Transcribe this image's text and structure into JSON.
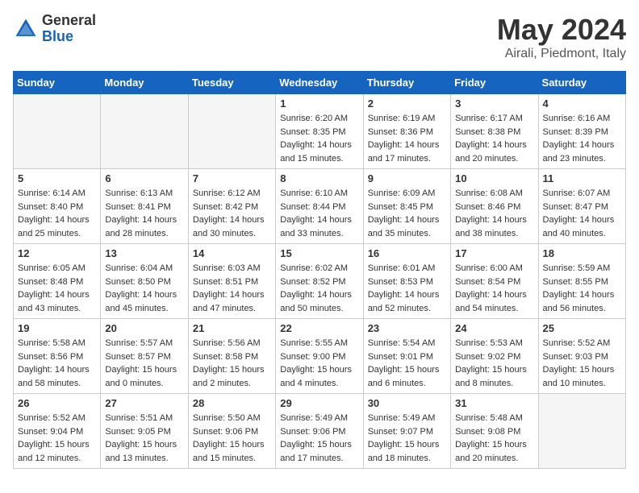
{
  "header": {
    "logo_general": "General",
    "logo_blue": "Blue",
    "month_year": "May 2024",
    "location": "Airali, Piedmont, Italy"
  },
  "days_of_week": [
    "Sunday",
    "Monday",
    "Tuesday",
    "Wednesday",
    "Thursday",
    "Friday",
    "Saturday"
  ],
  "weeks": [
    [
      {
        "day": "",
        "info": "",
        "empty": true
      },
      {
        "day": "",
        "info": "",
        "empty": true
      },
      {
        "day": "",
        "info": "",
        "empty": true
      },
      {
        "day": "1",
        "info": "Sunrise: 6:20 AM\nSunset: 8:35 PM\nDaylight: 14 hours\nand 15 minutes."
      },
      {
        "day": "2",
        "info": "Sunrise: 6:19 AM\nSunset: 8:36 PM\nDaylight: 14 hours\nand 17 minutes."
      },
      {
        "day": "3",
        "info": "Sunrise: 6:17 AM\nSunset: 8:38 PM\nDaylight: 14 hours\nand 20 minutes."
      },
      {
        "day": "4",
        "info": "Sunrise: 6:16 AM\nSunset: 8:39 PM\nDaylight: 14 hours\nand 23 minutes."
      }
    ],
    [
      {
        "day": "5",
        "info": "Sunrise: 6:14 AM\nSunset: 8:40 PM\nDaylight: 14 hours\nand 25 minutes."
      },
      {
        "day": "6",
        "info": "Sunrise: 6:13 AM\nSunset: 8:41 PM\nDaylight: 14 hours\nand 28 minutes."
      },
      {
        "day": "7",
        "info": "Sunrise: 6:12 AM\nSunset: 8:42 PM\nDaylight: 14 hours\nand 30 minutes."
      },
      {
        "day": "8",
        "info": "Sunrise: 6:10 AM\nSunset: 8:44 PM\nDaylight: 14 hours\nand 33 minutes."
      },
      {
        "day": "9",
        "info": "Sunrise: 6:09 AM\nSunset: 8:45 PM\nDaylight: 14 hours\nand 35 minutes."
      },
      {
        "day": "10",
        "info": "Sunrise: 6:08 AM\nSunset: 8:46 PM\nDaylight: 14 hours\nand 38 minutes."
      },
      {
        "day": "11",
        "info": "Sunrise: 6:07 AM\nSunset: 8:47 PM\nDaylight: 14 hours\nand 40 minutes."
      }
    ],
    [
      {
        "day": "12",
        "info": "Sunrise: 6:05 AM\nSunset: 8:48 PM\nDaylight: 14 hours\nand 43 minutes."
      },
      {
        "day": "13",
        "info": "Sunrise: 6:04 AM\nSunset: 8:50 PM\nDaylight: 14 hours\nand 45 minutes."
      },
      {
        "day": "14",
        "info": "Sunrise: 6:03 AM\nSunset: 8:51 PM\nDaylight: 14 hours\nand 47 minutes."
      },
      {
        "day": "15",
        "info": "Sunrise: 6:02 AM\nSunset: 8:52 PM\nDaylight: 14 hours\nand 50 minutes."
      },
      {
        "day": "16",
        "info": "Sunrise: 6:01 AM\nSunset: 8:53 PM\nDaylight: 14 hours\nand 52 minutes."
      },
      {
        "day": "17",
        "info": "Sunrise: 6:00 AM\nSunset: 8:54 PM\nDaylight: 14 hours\nand 54 minutes."
      },
      {
        "day": "18",
        "info": "Sunrise: 5:59 AM\nSunset: 8:55 PM\nDaylight: 14 hours\nand 56 minutes."
      }
    ],
    [
      {
        "day": "19",
        "info": "Sunrise: 5:58 AM\nSunset: 8:56 PM\nDaylight: 14 hours\nand 58 minutes."
      },
      {
        "day": "20",
        "info": "Sunrise: 5:57 AM\nSunset: 8:57 PM\nDaylight: 15 hours\nand 0 minutes."
      },
      {
        "day": "21",
        "info": "Sunrise: 5:56 AM\nSunset: 8:58 PM\nDaylight: 15 hours\nand 2 minutes."
      },
      {
        "day": "22",
        "info": "Sunrise: 5:55 AM\nSunset: 9:00 PM\nDaylight: 15 hours\nand 4 minutes."
      },
      {
        "day": "23",
        "info": "Sunrise: 5:54 AM\nSunset: 9:01 PM\nDaylight: 15 hours\nand 6 minutes."
      },
      {
        "day": "24",
        "info": "Sunrise: 5:53 AM\nSunset: 9:02 PM\nDaylight: 15 hours\nand 8 minutes."
      },
      {
        "day": "25",
        "info": "Sunrise: 5:52 AM\nSunset: 9:03 PM\nDaylight: 15 hours\nand 10 minutes."
      }
    ],
    [
      {
        "day": "26",
        "info": "Sunrise: 5:52 AM\nSunset: 9:04 PM\nDaylight: 15 hours\nand 12 minutes."
      },
      {
        "day": "27",
        "info": "Sunrise: 5:51 AM\nSunset: 9:05 PM\nDaylight: 15 hours\nand 13 minutes."
      },
      {
        "day": "28",
        "info": "Sunrise: 5:50 AM\nSunset: 9:06 PM\nDaylight: 15 hours\nand 15 minutes."
      },
      {
        "day": "29",
        "info": "Sunrise: 5:49 AM\nSunset: 9:06 PM\nDaylight: 15 hours\nand 17 minutes."
      },
      {
        "day": "30",
        "info": "Sunrise: 5:49 AM\nSunset: 9:07 PM\nDaylight: 15 hours\nand 18 minutes."
      },
      {
        "day": "31",
        "info": "Sunrise: 5:48 AM\nSunset: 9:08 PM\nDaylight: 15 hours\nand 20 minutes."
      },
      {
        "day": "",
        "info": "",
        "empty": true
      }
    ]
  ]
}
